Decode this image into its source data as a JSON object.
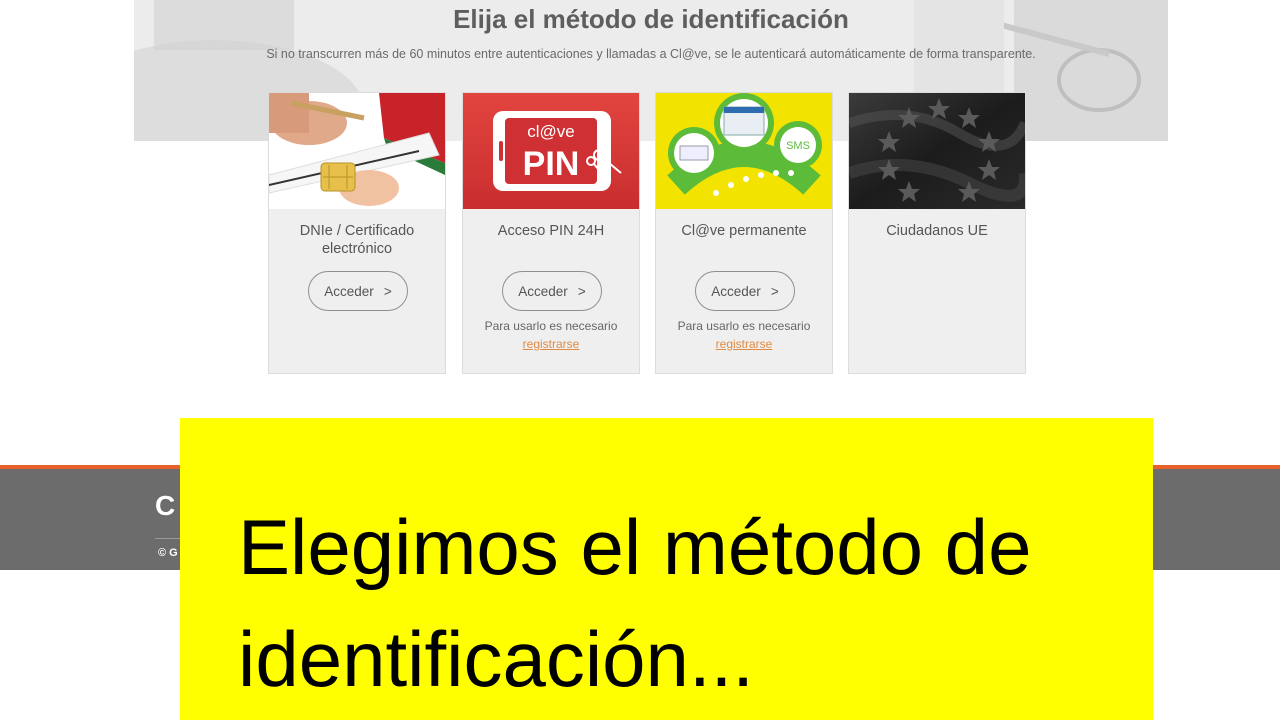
{
  "hero": {
    "title": "Elija el método de identificación",
    "subtitle": "Si no transcurren más de 60 minutos entre autenticaciones y llamadas a Cl@ve, se le autenticará automáticamente de forma transparente."
  },
  "cards": [
    {
      "title": "DNIe / Certificado electrónico",
      "button": "Acceder",
      "note": "",
      "link": ""
    },
    {
      "title": "Acceso PIN 24H",
      "button": "Acceder",
      "note": "Para usarlo es necesario",
      "link": "registrarse",
      "logo_top": "cl@ve",
      "logo_bottom": "PIN"
    },
    {
      "title": "Cl@ve permanente",
      "button": "Acceder",
      "note": "Para usarlo es necesario",
      "link": "registrarse",
      "badge": "SMS"
    },
    {
      "title": "Ciudadanos UE",
      "button": "",
      "note": "",
      "link": ""
    }
  ],
  "footer": {
    "logo": "C",
    "copyright": "© G"
  },
  "caption": {
    "text": "Elegimos el método de identificación..."
  },
  "icons": {
    "chevron": "chevron-right-icon"
  },
  "colors": {
    "accent": "#e8612a",
    "link": "#e08b44",
    "caption_bg": "#ffff00",
    "pin_red": "#d9383a",
    "clave_yellow": "#f2e000",
    "clave_green": "#5dbb3a"
  }
}
